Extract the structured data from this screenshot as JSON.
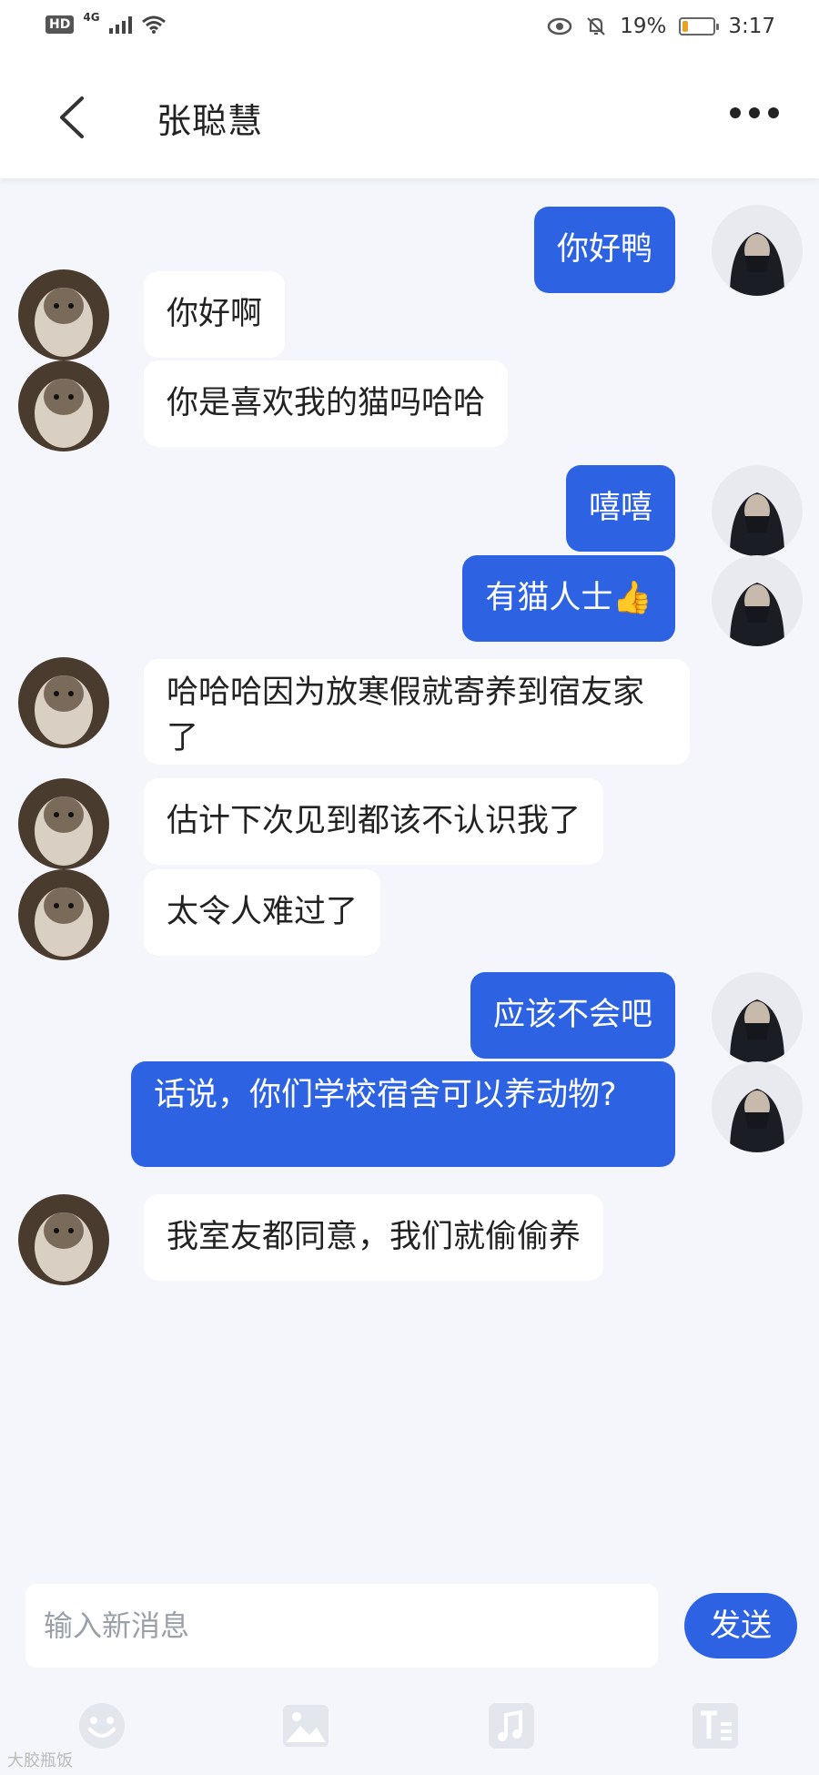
{
  "status_bar": {
    "hd": "HD",
    "network": "4G",
    "battery_percent": "19%",
    "battery_level": 0.19,
    "time": "3:17"
  },
  "header": {
    "title": "张聪慧",
    "back_icon": "chevron-left-icon",
    "more_icon": "more-dots-icon"
  },
  "messages": [
    {
      "side": "out",
      "text": "你好鸭"
    },
    {
      "side": "in",
      "text": "你好啊"
    },
    {
      "side": "in",
      "text": "你是喜欢我的猫吗哈哈"
    },
    {
      "side": "out",
      "text": "嘻嘻"
    },
    {
      "side": "out",
      "text": "有猫人士👍"
    },
    {
      "side": "in",
      "text": "哈哈哈因为放寒假就寄养到宿友家了"
    },
    {
      "side": "in",
      "text": "估计下次见到都该不认识我了"
    },
    {
      "side": "in",
      "text": "太令人难过了"
    },
    {
      "side": "out",
      "text": "应该不会吧"
    },
    {
      "side": "out",
      "text": "话说，你们学校宿舍可以养动物?"
    },
    {
      "side": "in",
      "text": "我室友都同意，我们就偷偷养"
    }
  ],
  "composer": {
    "placeholder": "输入新消息",
    "send_label": "发送"
  },
  "toolbar_icons": [
    "emoji-icon",
    "image-icon",
    "music-icon",
    "text-format-icon"
  ],
  "watermark": "大胶瓶饭",
  "colors": {
    "accent": "#2d63e3",
    "background": "#f4f6fb",
    "incoming_bubble": "#ffffff"
  }
}
